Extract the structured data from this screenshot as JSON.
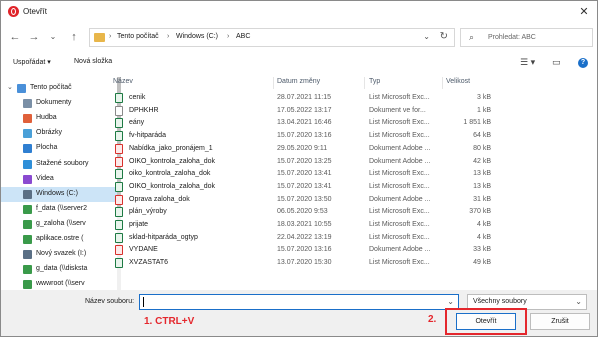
{
  "window": {
    "title": "Otevřít"
  },
  "nav": {
    "back": "←",
    "forward": "→",
    "up_list": "⌄",
    "up": "↑",
    "breadcrumb": [
      "Tento počítač",
      "Windows (C:)",
      "ABC"
    ],
    "search_placeholder": "Prohledat: ABC"
  },
  "toolbar": {
    "organize": "Uspořádat",
    "new_folder": "Nová složka"
  },
  "sidebar": {
    "items": [
      {
        "label": "Tento počítač",
        "icon": "computer-icon",
        "color": "#4a90d9"
      },
      {
        "label": "Dokumenty",
        "icon": "documents-icon",
        "color": "#7a8fa6"
      },
      {
        "label": "Hudba",
        "icon": "music-icon",
        "color": "#e0603a"
      },
      {
        "label": "Obrázky",
        "icon": "pictures-icon",
        "color": "#4aa0d8"
      },
      {
        "label": "Plocha",
        "icon": "desktop-icon",
        "color": "#2f7fd1"
      },
      {
        "label": "Stažené soubory",
        "icon": "downloads-icon",
        "color": "#2f8fd8"
      },
      {
        "label": "Videa",
        "icon": "videos-icon",
        "color": "#8a4ad0"
      },
      {
        "label": "Windows (C:)",
        "icon": "drive-icon",
        "color": "#5a6f85"
      },
      {
        "label": "f_data (\\\\server2",
        "icon": "network-drive-icon",
        "color": "#3a9a4a"
      },
      {
        "label": "g_zaloha (\\\\serv",
        "icon": "network-drive-icon",
        "color": "#3a9a4a"
      },
      {
        "label": "aplikace.ostre (",
        "icon": "network-drive-icon",
        "color": "#3a9a4a"
      },
      {
        "label": "Nový svazek (I:)",
        "icon": "drive-icon",
        "color": "#5a6f85"
      },
      {
        "label": "g_data (\\\\disksta",
        "icon": "network-drive-icon",
        "color": "#3a9a4a"
      },
      {
        "label": "wwwroot (\\\\serv",
        "icon": "network-drive-icon",
        "color": "#3a9a4a"
      }
    ],
    "selected": "Windows (C:)"
  },
  "filelist": {
    "columns": {
      "name": "Název",
      "date": "Datum změny",
      "type": "Typ",
      "size": "Velikost"
    },
    "rows": [
      {
        "name": "cenik",
        "date": "28.07.2021 11:15",
        "type": "List Microsoft Exc...",
        "size": "3 kB",
        "kind": "excel"
      },
      {
        "name": "DPHKHR",
        "date": "17.05.2022 13:17",
        "type": "Dokument ve for...",
        "size": "1 kB",
        "kind": "doc"
      },
      {
        "name": "eány",
        "date": "13.04.2021 16:46",
        "type": "List Microsoft Exc...",
        "size": "1 851 kB",
        "kind": "excel"
      },
      {
        "name": "fv-hitparáda",
        "date": "15.07.2020 13:16",
        "type": "List Microsoft Exc...",
        "size": "64 kB",
        "kind": "excel"
      },
      {
        "name": "Nabídka_jako_pronájem_1",
        "date": "29.05.2020 9:11",
        "type": "Dokument Adobe ...",
        "size": "80 kB",
        "kind": "pdf"
      },
      {
        "name": "OIKO_kontrola_zaloha_dok",
        "date": "15.07.2020 13:25",
        "type": "Dokument Adobe ...",
        "size": "42 kB",
        "kind": "pdf"
      },
      {
        "name": "oiko_kontrola_zaloha_dok",
        "date": "15.07.2020 13:41",
        "type": "List Microsoft Exc...",
        "size": "13 kB",
        "kind": "excel"
      },
      {
        "name": "OIKO_kontrola_zaloha_dok",
        "date": "15.07.2020 13:41",
        "type": "List Microsoft Exc...",
        "size": "13 kB",
        "kind": "excel"
      },
      {
        "name": "Oprava zaloha_dok",
        "date": "15.07.2020 13:50",
        "type": "Dokument Adobe ...",
        "size": "31 kB",
        "kind": "pdf"
      },
      {
        "name": "plán_výroby",
        "date": "06.05.2020 9:53",
        "type": "List Microsoft Exc...",
        "size": "370 kB",
        "kind": "excel"
      },
      {
        "name": "prijate",
        "date": "18.03.2021 10:55",
        "type": "List Microsoft Exc...",
        "size": "4 kB",
        "kind": "excel"
      },
      {
        "name": "sklad-hitparáda_ogtyp",
        "date": "22.04.2022 13:19",
        "type": "List Microsoft Exc...",
        "size": "4 kB",
        "kind": "excel"
      },
      {
        "name": "VYDANE",
        "date": "15.07.2020 13:16",
        "type": "Dokument Adobe ...",
        "size": "33 kB",
        "kind": "pdf"
      },
      {
        "name": "XVZASTAT6",
        "date": "13.07.2020 15:30",
        "type": "List Microsoft Exc...",
        "size": "49 kB",
        "kind": "excel"
      }
    ]
  },
  "bottom": {
    "filename_label": "Název souboru:",
    "filename_value": "",
    "filter": "Všechny soubory",
    "open_button": "Otevřít",
    "cancel_button": "Zrušit",
    "annotation_1": "1. CTRL+V",
    "annotation_2": "2."
  },
  "colors": {
    "accent": "#1a6fc9",
    "annotation": "#e4272d",
    "selection": "#cce4f7"
  }
}
